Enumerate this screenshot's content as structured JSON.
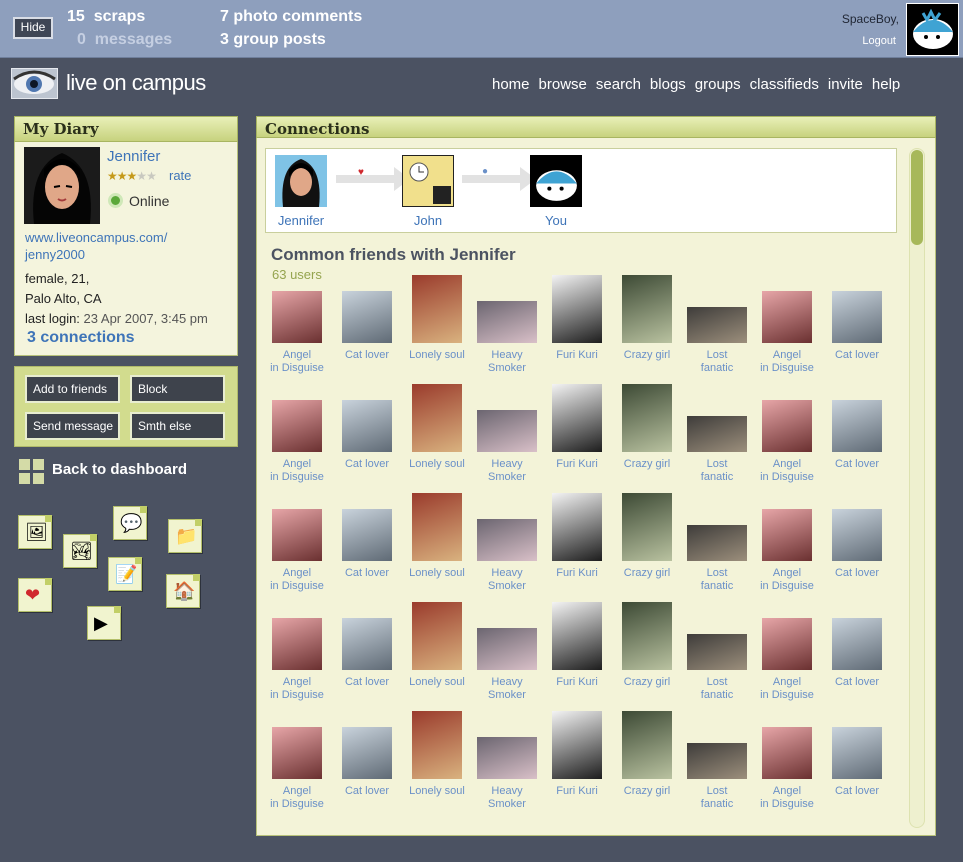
{
  "topbar": {
    "hide_label": "Hide",
    "scraps_count": "15",
    "scraps_label": "scraps",
    "messages_count": "0",
    "messages_label": "messages",
    "photo_comments_count": "7",
    "photo_comments_label": "photo comments",
    "group_posts_count": "3",
    "group_posts_label": "group posts",
    "username": "SpaceBoy,",
    "logout_label": "Logout"
  },
  "header": {
    "logo_text": "live on campus",
    "nav": [
      "home",
      "browse",
      "search",
      "blogs",
      "groups",
      "classifieds",
      "invite",
      "help"
    ]
  },
  "diary": {
    "title": "My Diary",
    "name": "Jennifer",
    "rating": 3,
    "rating_max": 5,
    "rate_label": "rate",
    "status": "Online",
    "url_line1": "www.liveoncampus.com/",
    "url_line2": "jenny2000",
    "info_line1": "female, 21,",
    "info_line2": "Palo Alto, CA",
    "last_login_label": "last login:",
    "last_login_value": "23 Apr 2007, 3:45 pm",
    "connections": "3 connections"
  },
  "actions": {
    "add_friends": "Add to friends",
    "block": "Block",
    "send_message": "Send message",
    "smth_else": "Smth else"
  },
  "back_dashboard": "Back to dashboard",
  "dashboard_tiles": [
    "photo-icon",
    "gallery-icon",
    "chat-icon",
    "folder-icon",
    "heart-icon",
    "notepad-icon",
    "house-icon",
    "video-icon"
  ],
  "connections": {
    "title": "Connections",
    "path": [
      "Jennifer",
      "John",
      "You"
    ],
    "common_title": "Common friends with Jennifer",
    "common_count": "63 users",
    "friends": [
      [
        "Angel",
        "in Disguise"
      ],
      [
        "Cat lover",
        ""
      ],
      [
        "Lonely soul",
        ""
      ],
      [
        "Heavy",
        "Smoker"
      ],
      [
        "Furi Kuri",
        ""
      ],
      [
        "Crazy girl",
        ""
      ],
      [
        "Lost",
        "fanatic"
      ],
      [
        "Angel",
        "in Disguise"
      ],
      [
        "Cat lover",
        ""
      ]
    ],
    "rows": 5
  },
  "colors": {
    "background": "#4b5262",
    "topbar": "#8e9fbd",
    "panel_head": "#c7d27e",
    "link": "#3e74b8",
    "friend_link": "#6a90c8",
    "count_green": "#95a44f"
  }
}
